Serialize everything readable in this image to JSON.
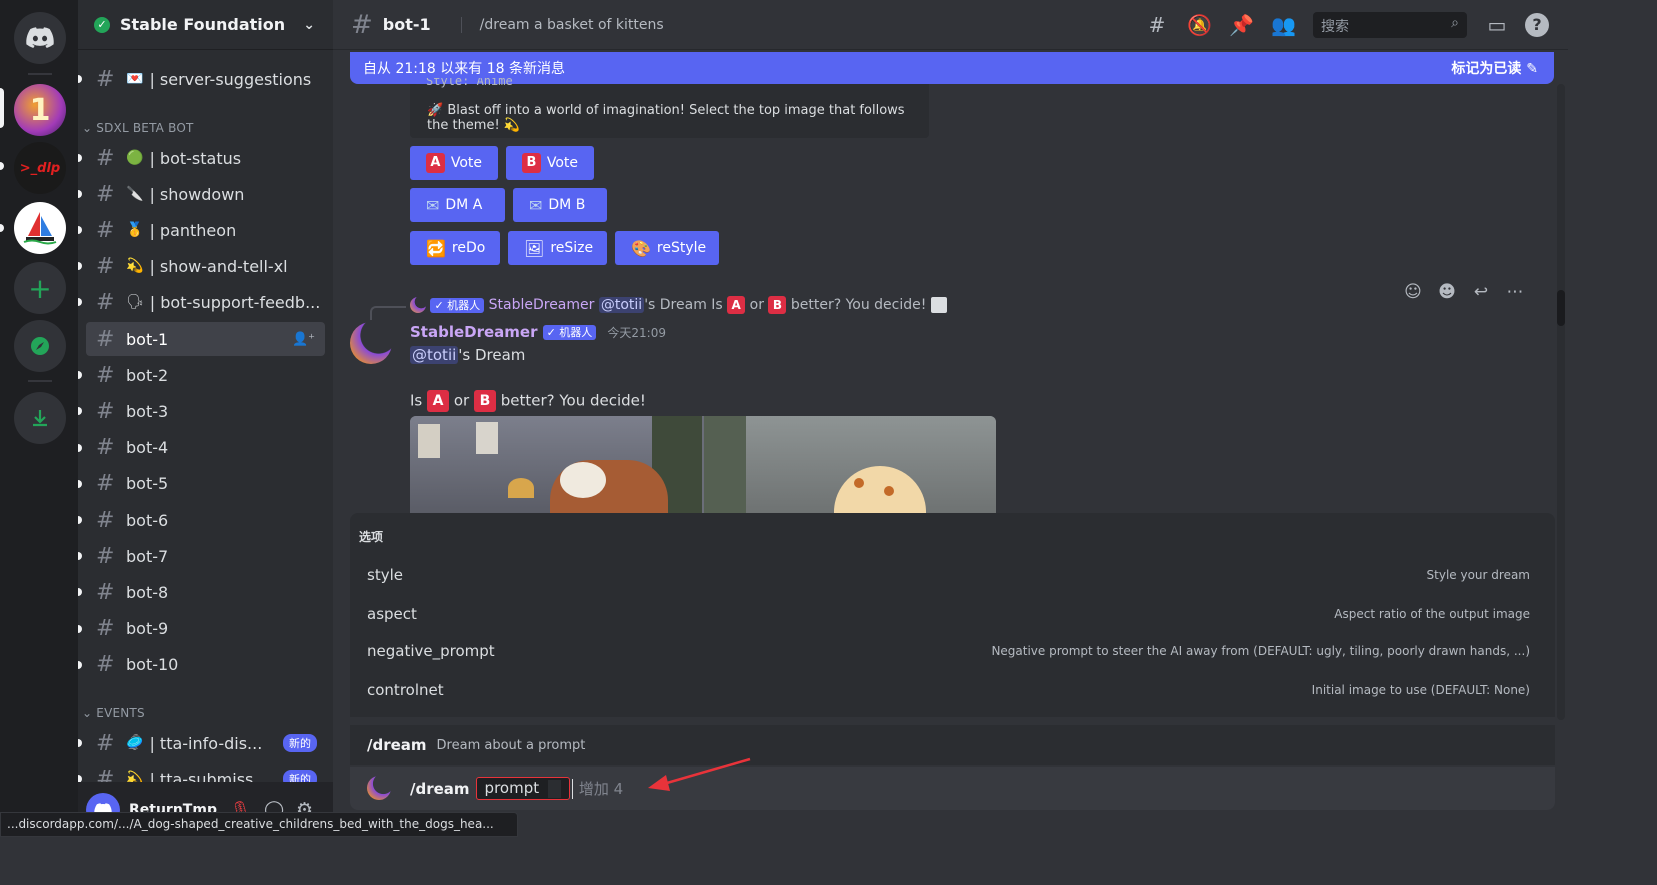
{
  "server_list": {
    "items": [
      {
        "name": "discord-home",
        "label": ""
      },
      {
        "name": "server-1",
        "label": "1"
      },
      {
        "name": "server-dlp",
        "label": ">_dlp"
      },
      {
        "name": "server-sailboat",
        "label": ""
      },
      {
        "name": "add-server",
        "label": "+"
      },
      {
        "name": "explore",
        "label": ""
      },
      {
        "name": "download",
        "label": ""
      }
    ]
  },
  "sidebar": {
    "server_name": "Stable Foundation",
    "category_sdxl": "SDXL BETA BOT",
    "category_events": "EVENTS",
    "channels_top": [
      {
        "emoji": "💌",
        "label": "| server-suggestions"
      }
    ],
    "channels_sdxl": [
      {
        "emoji": "🟢",
        "label": "| bot-status"
      },
      {
        "emoji": "🔪",
        "label": "| showdown"
      },
      {
        "emoji": "🥇",
        "label": "| pantheon"
      },
      {
        "emoji": "💫",
        "label": "| show-and-tell-xl"
      },
      {
        "emoji": "🗣",
        "label": "| bot-support-feedb..."
      }
    ],
    "bot_channels": [
      "bot-1",
      "bot-2",
      "bot-3",
      "bot-4",
      "bot-5",
      "bot-6",
      "bot-7",
      "bot-8",
      "bot-9",
      "bot-10"
    ],
    "events": [
      {
        "emoji": "🥏",
        "label": "| tta-info-dis...",
        "badge": "新的"
      },
      {
        "emoji": "💫",
        "label": "| tta-submiss...",
        "badge": "新的"
      }
    ],
    "user_name": "ReturnTmp"
  },
  "header": {
    "channel": "bot-1",
    "topic": "/dream a basket of kittens",
    "search_placeholder": "搜索"
  },
  "new_messages": {
    "text": "自从 21:18 以来有 18 条新消息",
    "mark_read": "标记为已读"
  },
  "embed": {
    "style_line": "Style: Anime",
    "text": "🚀 Blast off into a world of imagination! Select the top image that follows the theme! 💫"
  },
  "buttons": {
    "vote_a": {
      "emoji": "A",
      "label": "Vote"
    },
    "vote_b": {
      "emoji": "B",
      "label": "Vote"
    },
    "dm_a": {
      "emoji": "✉",
      "label": "DM A"
    },
    "dm_b": {
      "emoji": "✉",
      "label": "DM B"
    },
    "redo": {
      "emoji": "🔁",
      "label": "reDo"
    },
    "resize": {
      "emoji": "🖼",
      "label": "reSize"
    },
    "restyle": {
      "emoji": "🎨",
      "label": "reStyle"
    }
  },
  "message": {
    "reply_tag": "✓ 机器人",
    "reply_author": "StableDreamer",
    "reply_mention": "@totii",
    "reply_text_1": "'s Dream Is",
    "reply_text_2": "or",
    "reply_text_3": "better? You decide!",
    "author": "StableDreamer",
    "bot_tag": "✓ 机器人",
    "time": "今天21:09",
    "mention": "@totii",
    "line1_rest": "'s Dream",
    "line2_prefix": "Is",
    "line2_mid": "or",
    "line2_suffix": "better? You decide!"
  },
  "options": {
    "title": "选项",
    "items": [
      {
        "name": "style",
        "desc": "Style your dream"
      },
      {
        "name": "aspect",
        "desc": "Aspect ratio of the output image"
      },
      {
        "name": "negative_prompt",
        "desc": "Negative prompt to steer the AI away from (DEFAULT: ugly, tiling, poorly drawn hands, ...)"
      },
      {
        "name": "controlnet",
        "desc": "Initial image to use (DEFAULT: None)"
      }
    ]
  },
  "command": {
    "name": "/dream",
    "desc": "Dream about a prompt",
    "param": "prompt",
    "more": "增加 4"
  },
  "status_url": "...discordapp.com/.../A_dog-shaped_creative_childrens_bed_with_the_dogs_hea...",
  "colors": {
    "blurple": "#5865f2",
    "red_arrow": "#e8333a",
    "emoji_red": "#dd2e44"
  }
}
